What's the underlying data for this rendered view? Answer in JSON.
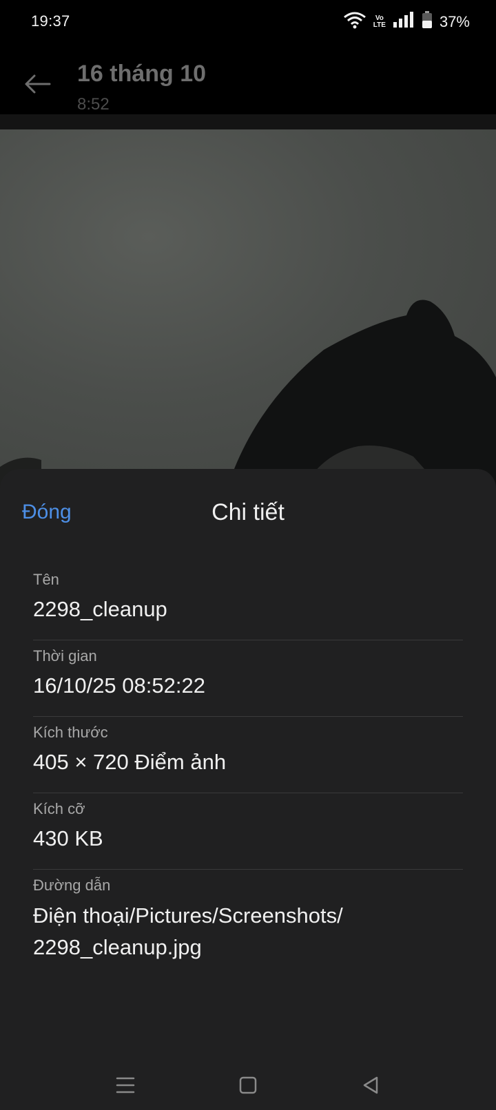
{
  "status_bar": {
    "time": "19:37",
    "volte_top": "Vo",
    "volte_bottom": "LTE",
    "battery": "37%",
    "icons": [
      "wifi-icon",
      "volte-icon",
      "signal-icon",
      "battery-icon"
    ]
  },
  "header": {
    "title": "16 tháng 10",
    "subtitle": "8:52",
    "back_icon": "arrow-left-icon"
  },
  "sheet": {
    "close_label": "Đóng",
    "title": "Chi tiết",
    "details": [
      {
        "label": "Tên",
        "value": "2298_cleanup"
      },
      {
        "label": "Thời gian",
        "value": "16/10/25 08:52:22"
      },
      {
        "label": "Kích thước",
        "value": "405 × 720 Điểm ảnh"
      },
      {
        "label": "Kích cỡ",
        "value": "430 KB"
      },
      {
        "label": "Đường dẫn",
        "value_line1": "Điện thoại/Pictures/Screenshots/",
        "value_line2": "2298_cleanup.jpg"
      }
    ]
  },
  "nav_bar": {
    "icons": [
      "menu-icon",
      "home-square-icon",
      "back-triangle-icon"
    ]
  },
  "colors": {
    "accent": "#4d8fe6",
    "sheet_bg": "#202021",
    "label": "#a8a8a8"
  }
}
